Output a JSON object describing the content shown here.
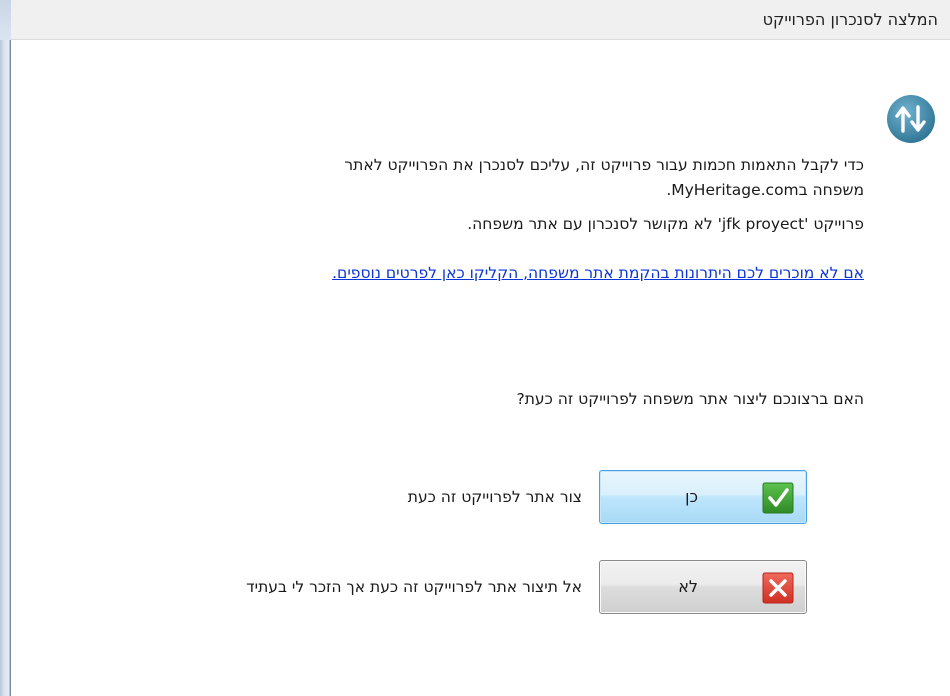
{
  "window": {
    "title": "המלצה לסנכרון הפרוייקט"
  },
  "icon": {
    "name": "sync-arrows-icon",
    "color": "#3f86a8"
  },
  "message": {
    "line1": "כדי לקבל התאמות חכמות עבור פרוייקט זה, עליכם לסנכרן את הפרוייקט לאתר",
    "line2": "משפחה בMyHeritage.com.",
    "line3": "פרוייקט 'jfk proyect' לא מקושר לסנכרון עם אתר משפחה."
  },
  "learn_more_link": "אם לא מוכרים לכם היתרונות בהקמת אתר משפחה, הקליקו כאן לפרטים נוספים.",
  "question": "האם ברצונכם ליצור אתר משפחה לפרוייקט זה כעת?",
  "options": {
    "yes": {
      "button_label": "כן",
      "description": "צור אתר לפרוייקט זה כעת",
      "icon": "checkmark-icon",
      "icon_color": "#3aa12f"
    },
    "no": {
      "button_label": "לא",
      "description": "אל תיצור אתר לפרוייקט זה כעת אך הזכר לי בעתיד",
      "icon": "x-icon",
      "icon_color": "#e0453a"
    }
  }
}
